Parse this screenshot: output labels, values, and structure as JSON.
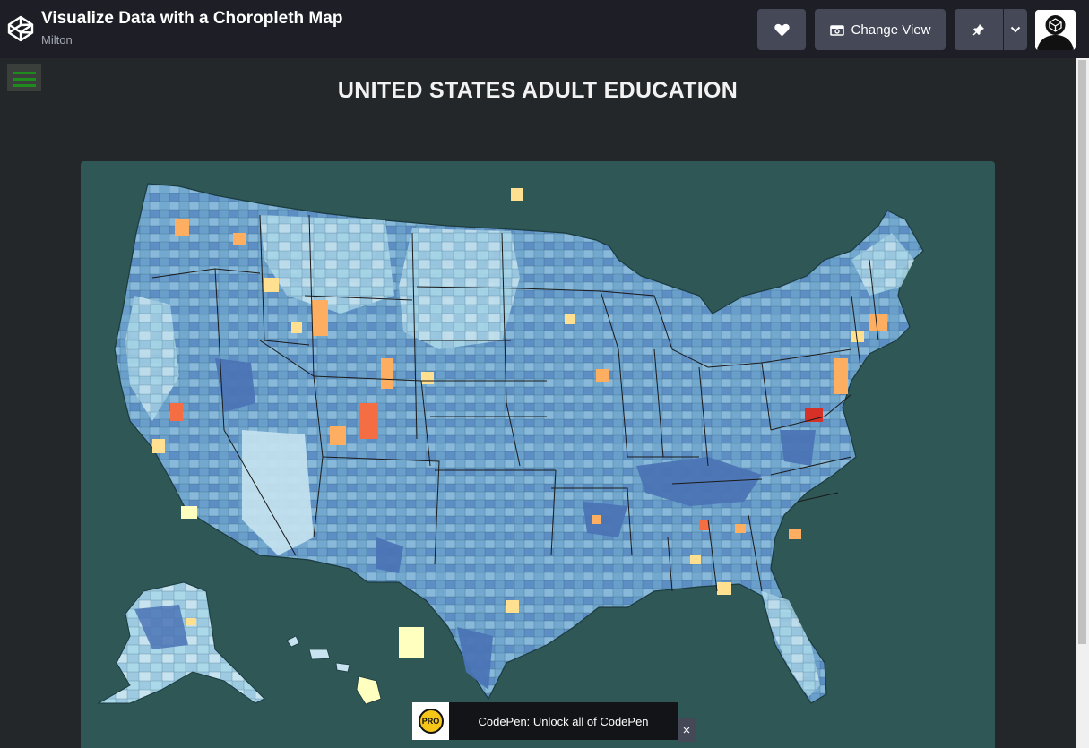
{
  "header": {
    "pen_title": "Visualize Data with a Choropleth Map",
    "author": "Milton",
    "change_view_label": "Change View"
  },
  "icons": [
    "codepen-logo-icon",
    "heart-icon",
    "change-view-icon",
    "pin-icon",
    "chevron-down-icon",
    "avatar-icon",
    "menu-icon",
    "close-icon",
    "pro-badge-icon"
  ],
  "preview": {
    "page_title": "UNITED STATES ADULT EDUCATION"
  },
  "map": {
    "type": "choropleth",
    "colors": {
      "background": "#2e5756",
      "dark_blue": "#4b74b5",
      "mid_blue": "#74a9cf",
      "light_blue": "#abd9e9",
      "pale": "#e0f3f8",
      "pale_yellow": "#ffffbf",
      "orange": "#fdae61",
      "red": "#d73027"
    }
  },
  "banner": {
    "pro_label": "PRO",
    "text": "CodePen: Unlock all of CodePen",
    "close": "×"
  },
  "colors": {
    "header_bg": "#1e1f26",
    "button_bg": "#444857",
    "preview_bg": "#23272a"
  }
}
